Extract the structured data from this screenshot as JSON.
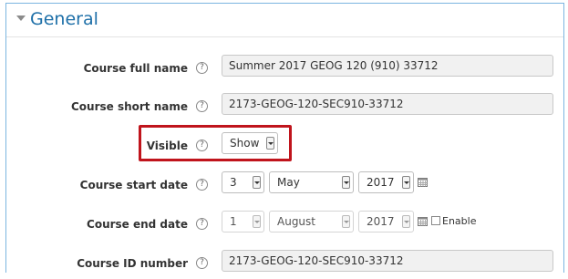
{
  "section": {
    "title": "General"
  },
  "fields": {
    "fullname": {
      "label": "Course full name",
      "value": "Summer 2017 GEOG 120 (910) 33712"
    },
    "shortname": {
      "label": "Course short name",
      "value": "2173-GEOG-120-SEC910-33712"
    },
    "visible": {
      "label": "Visible",
      "value": "Show"
    },
    "startdate": {
      "label": "Course start date",
      "day": "3",
      "month": "May",
      "year": "2017"
    },
    "enddate": {
      "label": "Course end date",
      "day": "1",
      "month": "August",
      "year": "2017",
      "enable_label": "Enable",
      "enabled": false
    },
    "idnumber": {
      "label": "Course ID number",
      "value": "2173-GEOG-120-SEC910-33712"
    }
  },
  "help_glyph": "?",
  "colors": {
    "title": "#1d6fa8",
    "highlight": "#c0141c",
    "frame": "#7cb5e0"
  }
}
